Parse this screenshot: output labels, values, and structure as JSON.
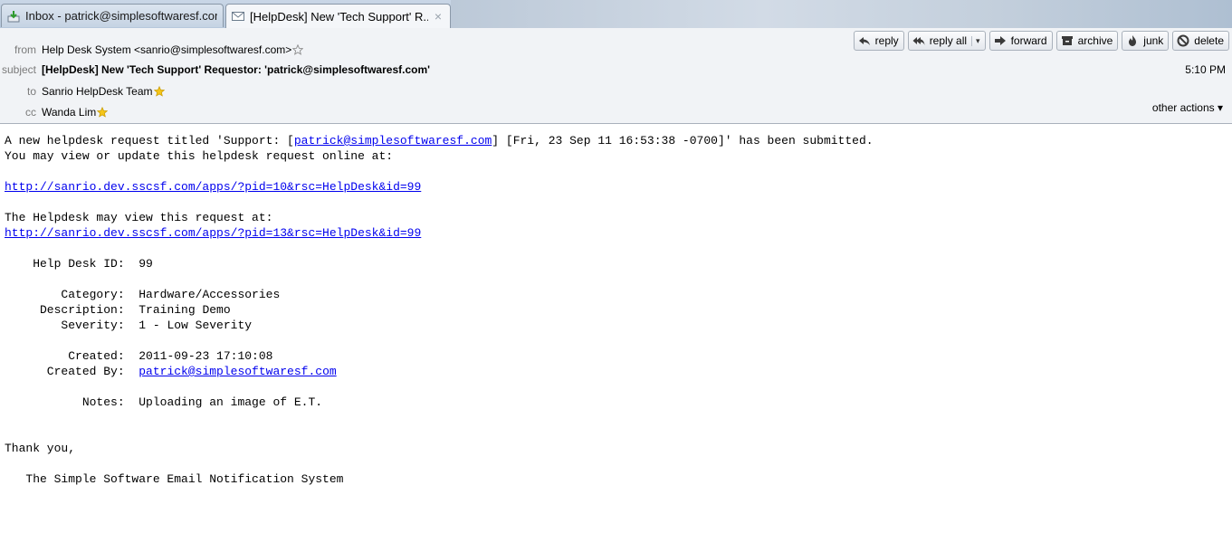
{
  "tabs": [
    {
      "label": "Inbox - patrick@simplesoftwaresf.com",
      "icon": "inbox-download-icon",
      "active": false
    },
    {
      "label": "[HelpDesk] New 'Tech Support' R...",
      "icon": "envelope-icon",
      "active": true,
      "close": "×"
    }
  ],
  "header": {
    "from_label": "from",
    "from_value": "Help Desk System <sanrio@simplesoftwaresf.com>",
    "subject_label": "subject",
    "subject_value": "[HelpDesk] New 'Tech Support' Requestor: 'patrick@simplesoftwaresf.com'",
    "to_label": "to",
    "to_value": "Sanrio HelpDesk Team",
    "cc_label": "cc",
    "cc_value": "Wanda Lim",
    "date": "5:10 PM",
    "other_actions": "other actions ▾"
  },
  "toolbar": {
    "reply": "reply",
    "reply_all": "reply all",
    "reply_all_arrow": "▾",
    "forward": "forward",
    "archive": "archive",
    "junk": "junk",
    "delete": "delete"
  },
  "message": {
    "intro_1": "A new helpdesk request titled 'Support: [",
    "intro_link": "patrick@simplesoftwaresf.com",
    "intro_2": "] [Fri, 23 Sep 11 16:53:38 -0700]' has been submitted.",
    "line2": "You may view or update this helpdesk request online at:",
    "url1": "http://sanrio.dev.sscsf.com/apps/?pid=10&rsc=HelpDesk&id=99",
    "line_helpdesk": "The Helpdesk may view this request at:",
    "url2": "http://sanrio.dev.sscsf.com/apps/?pid=13&rsc=HelpDesk&id=99",
    "id_label": "    Help Desk ID:  ",
    "id_value": "99",
    "category_label": "        Category:  ",
    "category_value": "Hardware/Accessories",
    "description_label": "     Description:  ",
    "description_value": "Training Demo",
    "severity_label": "        Severity:  ",
    "severity_value": "1 - Low Severity",
    "created_label": "         Created:  ",
    "created_value": "2011-09-23 17:10:08",
    "created_by_label": "      Created By:  ",
    "created_by_value": "patrick@simplesoftwaresf.com",
    "notes_label": "           Notes:  ",
    "notes_value": "Uploading an image of E.T.",
    "thanks": "Thank you,",
    "signature": "   The Simple Software Email Notification System"
  },
  "colors": {
    "link": "#0000ee",
    "header_bg": "#f1f3f6",
    "star": "#f5c518"
  }
}
